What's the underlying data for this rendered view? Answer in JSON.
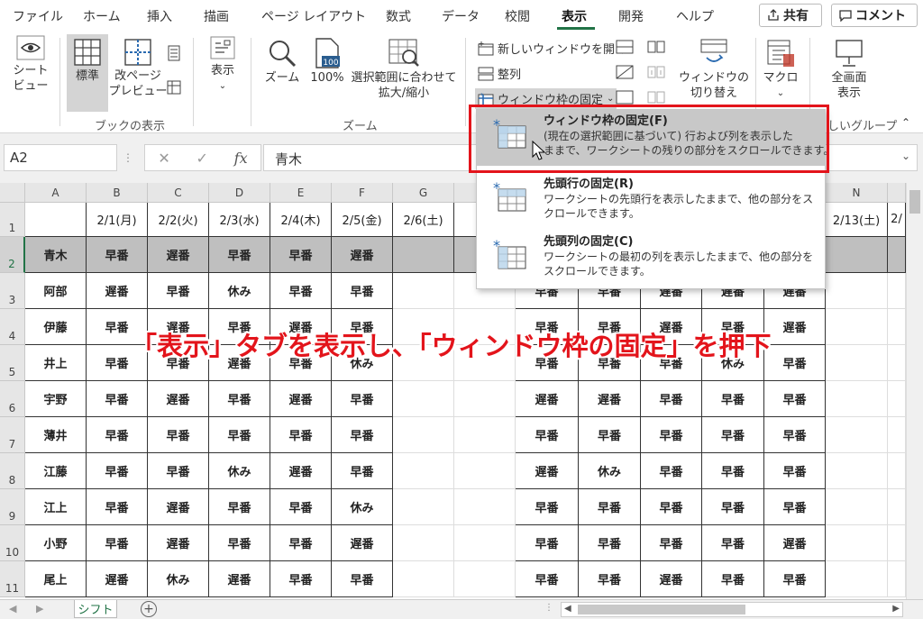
{
  "menu": {
    "tabs": [
      "ファイル",
      "ホーム",
      "挿入",
      "描画",
      "ページ レイアウト",
      "数式",
      "データ",
      "校閲",
      "表示",
      "開発",
      "ヘルプ"
    ],
    "active_tab": "表示",
    "share_label": "共有",
    "comment_label": "コメント"
  },
  "ribbon": {
    "sheet_view": "シート\nビュー",
    "normal": "標準",
    "page_break": "改ページ\nプレビュー",
    "show": "表示",
    "zoom": "ズーム",
    "zoom100": "100%",
    "zoom_selection": "選択範囲に合わせて\n拡大/縮小",
    "new_window": "新しいウィンドウを開く",
    "arrange": "整列",
    "freeze_panes": "ウィンドウ枠の固定",
    "switch_window": "ウィンドウの\n切り替え",
    "macro": "マクロ",
    "fullscreen": "全画面\n表示",
    "group_book_view": "ブックの表示",
    "group_zoom": "ズーム",
    "group_new": "しいグループ"
  },
  "formula_bar": {
    "name_box": "A2",
    "fx": "fx",
    "value": "青木"
  },
  "dropdown": {
    "items": [
      {
        "title": "ウィンドウ枠の固定(F)",
        "desc": "(現在の選択範囲に基づいて) 行および列を表示した\nままで、ワークシートの残りの部分をスクロールできます。"
      },
      {
        "title": "先頭行の固定(R)",
        "desc": "ワークシートの先頭行を表示したままで、他の部分をス\nクロールできます。"
      },
      {
        "title": "先頭列の固定(C)",
        "desc": "ワークシートの最初の列を表示したままで、他の部分を\nスクロールできます。"
      }
    ]
  },
  "grid": {
    "columns": [
      "A",
      "B",
      "C",
      "D",
      "E",
      "F",
      "G",
      "",
      "",
      "",
      "",
      "",
      "",
      "N",
      ""
    ],
    "dates": [
      "",
      "2/1(月)",
      "2/2(火)",
      "2/3(水)",
      "2/4(木)",
      "2/5(金)",
      "2/6(土)",
      "2/",
      "",
      "",
      "",
      "",
      "",
      "2/13(土)",
      "2/"
    ],
    "rows": [
      {
        "num": "2",
        "name": "青木",
        "left": [
          "早番",
          "遅番",
          "早番",
          "早番",
          "遅番"
        ],
        "right": [
          "",
          "",
          "",
          "",
          ""
        ]
      },
      {
        "num": "3",
        "name": "阿部",
        "left": [
          "遅番",
          "早番",
          "休み",
          "早番",
          "早番"
        ],
        "right": [
          "早番",
          "早番",
          "遅番",
          "遅番",
          "遅番"
        ]
      },
      {
        "num": "4",
        "name": "伊藤",
        "left": [
          "早番",
          "遅番",
          "早番",
          "遅番",
          "早番"
        ],
        "right": [
          "早番",
          "早番",
          "遅番",
          "早番",
          "遅番"
        ]
      },
      {
        "num": "5",
        "name": "井上",
        "left": [
          "早番",
          "早番",
          "遅番",
          "早番",
          "休み"
        ],
        "right": [
          "早番",
          "早番",
          "早番",
          "休み",
          "早番"
        ]
      },
      {
        "num": "6",
        "name": "宇野",
        "left": [
          "早番",
          "遅番",
          "早番",
          "遅番",
          "早番"
        ],
        "right": [
          "遅番",
          "遅番",
          "早番",
          "早番",
          "早番"
        ]
      },
      {
        "num": "7",
        "name": "薄井",
        "left": [
          "早番",
          "早番",
          "早番",
          "早番",
          "早番"
        ],
        "right": [
          "早番",
          "早番",
          "早番",
          "早番",
          "早番"
        ]
      },
      {
        "num": "8",
        "name": "江藤",
        "left": [
          "早番",
          "早番",
          "休み",
          "遅番",
          "早番"
        ],
        "right": [
          "遅番",
          "休み",
          "早番",
          "早番",
          "早番"
        ]
      },
      {
        "num": "9",
        "name": "江上",
        "left": [
          "早番",
          "遅番",
          "早番",
          "早番",
          "休み"
        ],
        "right": [
          "早番",
          "早番",
          "早番",
          "早番",
          "早番"
        ]
      },
      {
        "num": "10",
        "name": "小野",
        "left": [
          "早番",
          "遅番",
          "早番",
          "早番",
          "遅番"
        ],
        "right": [
          "早番",
          "早番",
          "早番",
          "早番",
          "遅番"
        ]
      },
      {
        "num": "11",
        "name": "尾上",
        "left": [
          "遅番",
          "休み",
          "遅番",
          "早番",
          "早番"
        ],
        "right": [
          "早番",
          "早番",
          "遅番",
          "早番",
          "早番"
        ]
      }
    ]
  },
  "sheet_tab": "シフト",
  "caption": "「表示」タブを表示し、「ウィンドウ枠の固定」を押下",
  "colors": {
    "accent": "#217346",
    "highlight_red": "#e3141b"
  }
}
